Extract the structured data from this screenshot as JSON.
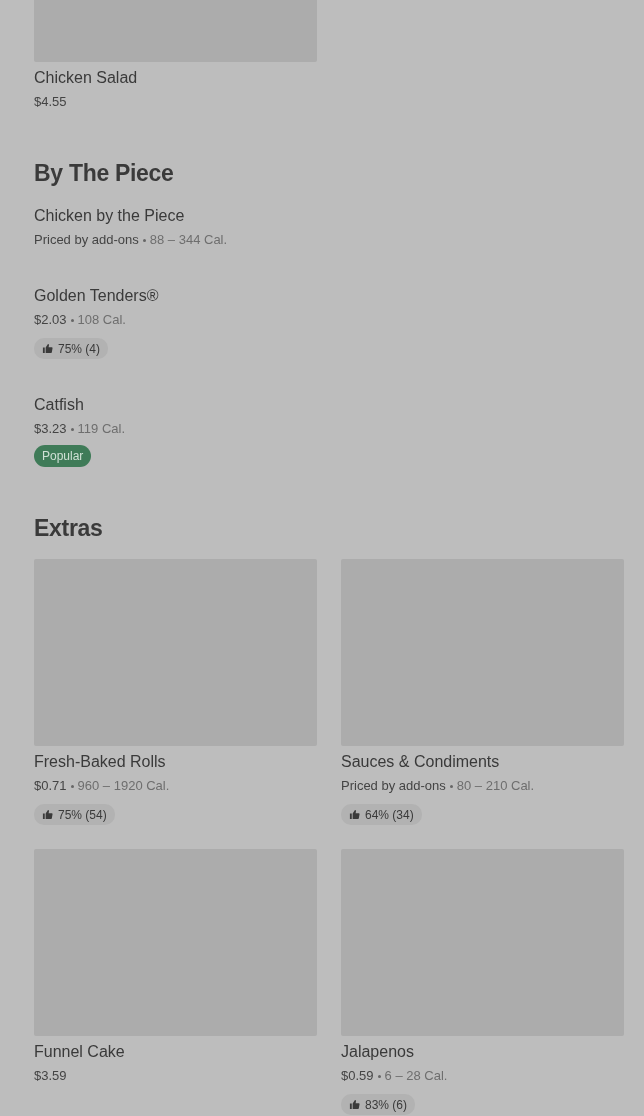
{
  "sections": [
    {
      "kind": "grid",
      "items": [
        {
          "name": "Chicken Salad",
          "price": "$4.55"
        }
      ]
    },
    {
      "title": "By The Piece",
      "kind": "list",
      "items": [
        {
          "name": "Chicken by the Piece",
          "price": "Priced by add-ons",
          "calories": "88 – 344 Cal."
        },
        {
          "name": "Golden Tenders®",
          "price": "$2.03",
          "calories": "108 Cal.",
          "rating": "75% (4)"
        },
        {
          "name": "Catfish",
          "price": "$3.23",
          "calories": "119 Cal.",
          "badge": "Popular"
        }
      ]
    },
    {
      "title": "Extras",
      "kind": "grid",
      "items": [
        {
          "name": "Fresh-Baked Rolls",
          "price": "$0.71",
          "calories": "960 – 1920 Cal.",
          "rating": "75% (54)"
        },
        {
          "name": "Sauces & Condiments",
          "price": "Priced by add-ons",
          "calories": "80 – 210 Cal.",
          "rating": "64% (34)"
        },
        {
          "name": "Funnel Cake",
          "price": "$3.59"
        },
        {
          "name": "Jalapenos",
          "price": "$0.59",
          "calories": "6 – 28 Cal.",
          "rating": "83% (6)"
        }
      ]
    }
  ]
}
